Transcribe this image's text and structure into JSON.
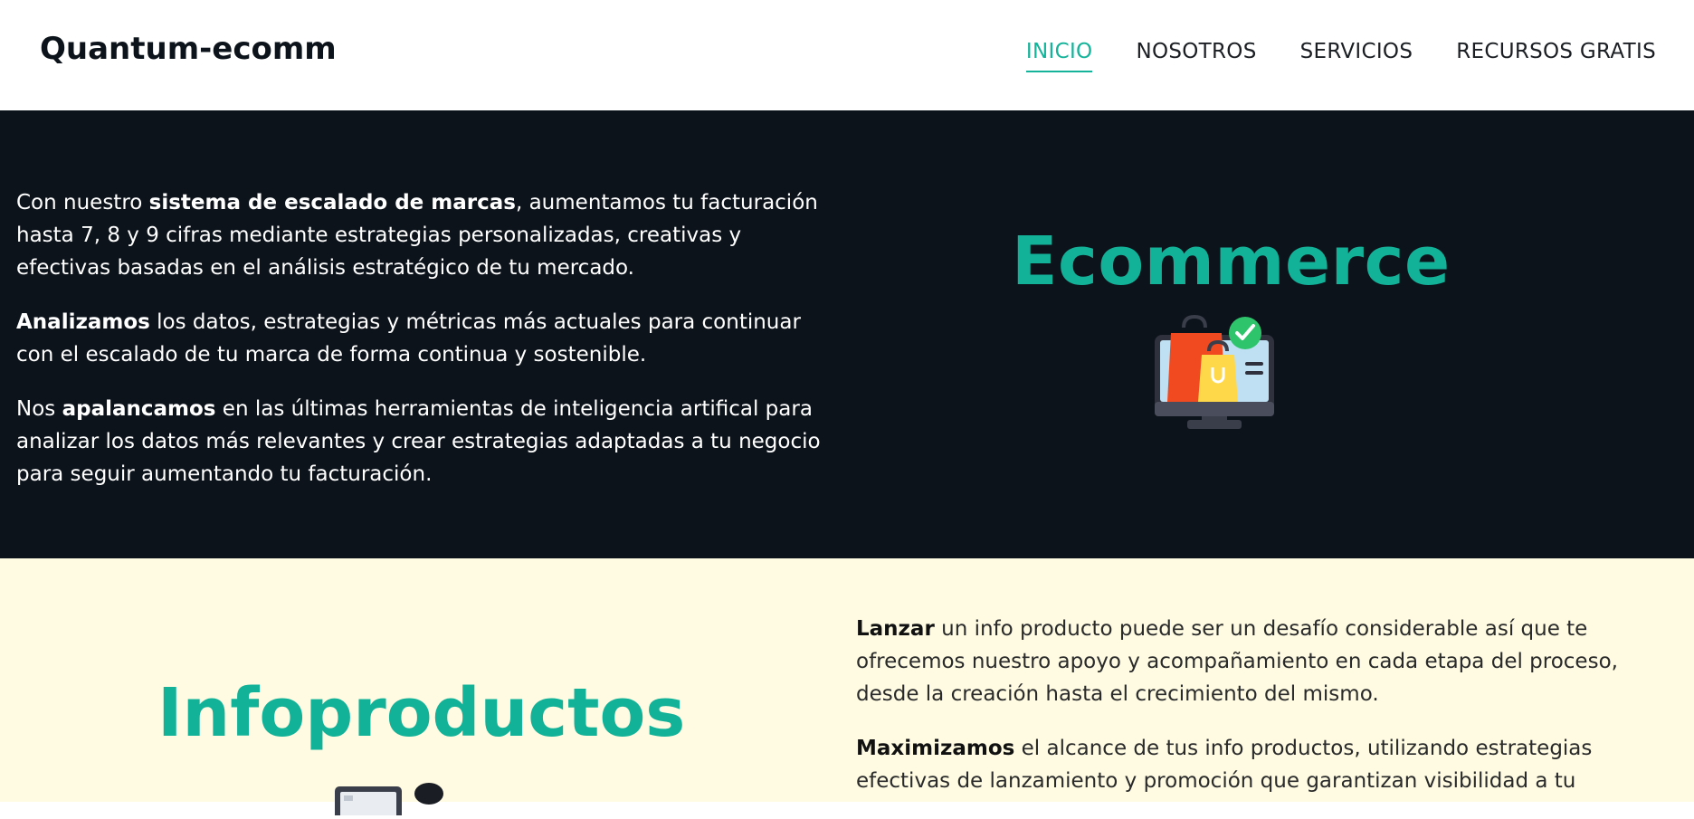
{
  "header": {
    "logo": "Quantum-ecomm",
    "nav": [
      {
        "label": "INICIO",
        "active": true
      },
      {
        "label": "NOSOTROS",
        "active": false
      },
      {
        "label": "SERVICIOS",
        "active": false
      },
      {
        "label": "RECURSOS GRATIS",
        "active": false
      }
    ]
  },
  "ecommerce": {
    "title": "Ecommerce",
    "icon": "shopping-monitor-icon",
    "p1": {
      "a": "Con nuestro ",
      "b": "sistema de escalado de marcas",
      "c": ", aumentamos tu facturación hasta 7, 8 y 9 cifras mediante estrategias personalizadas, creativas y efectivas basadas en el análisis estratégico de tu mercado."
    },
    "p2": {
      "b": "Analizamos",
      "c": " los datos, estrategias y métricas más actuales para continuar con el escalado de tu marca de forma continua y sostenible."
    },
    "p3": {
      "a": "Nos ",
      "b": "apalancamos",
      "c": " en las últimas herramientas de inteligencia artifical para analizar los datos más relevantes y crear estrategias adaptadas a tu negocio para seguir aumentando tu facturación."
    }
  },
  "infoproductos": {
    "title": "Infoproductos",
    "icon": "laptop-icon",
    "p1": {
      "b": "Lanzar",
      "c": " un info producto puede ser un desafío considerable así que te ofrecemos nuestro apoyo y acompañamiento en cada etapa del proceso, desde la creación hasta el crecimiento del mismo."
    },
    "p2": {
      "b": "Maximizamos",
      "c": " el alcance de tus info productos, utilizando estrategias efectivas de lanzamiento y promoción que garantizan visibilidad a tu"
    }
  },
  "colors": {
    "accent": "#12b299",
    "dark_bg": "#0d131b",
    "cream_bg": "#fefbe2"
  }
}
